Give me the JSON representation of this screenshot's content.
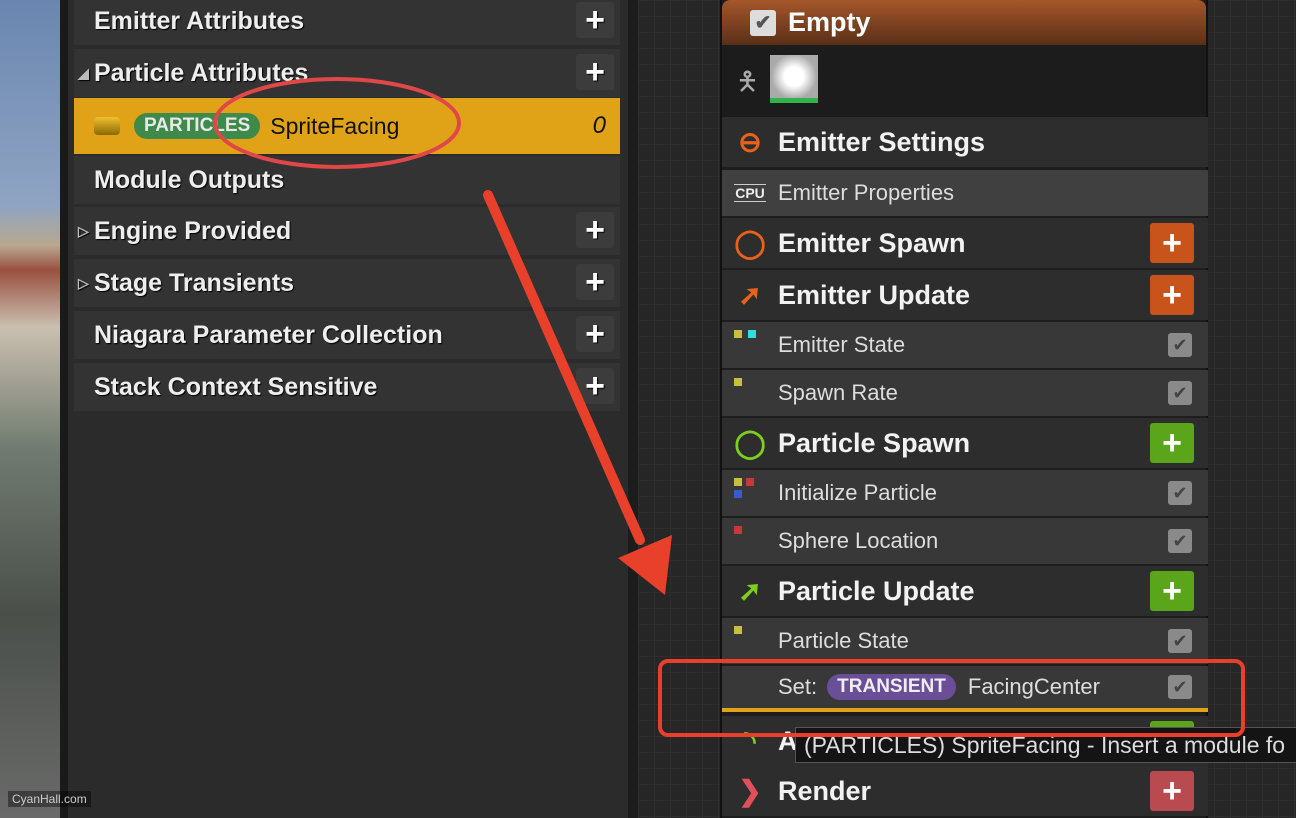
{
  "left_panel": {
    "sections": [
      {
        "label": "Emitter Attributes",
        "expander": "none",
        "has_add": true
      },
      {
        "label": "Particle Attributes",
        "expander": "expanded",
        "has_add": true
      },
      {
        "label": "Module Outputs",
        "expander": "none",
        "has_add": false
      },
      {
        "label": "Engine Provided",
        "expander": "collapsed",
        "has_add": true
      },
      {
        "label": "Stage Transients",
        "expander": "collapsed",
        "has_add": true
      },
      {
        "label": "Niagara Parameter Collection",
        "expander": "none",
        "has_add": true
      },
      {
        "label": "Stack Context Sensitive",
        "expander": "none",
        "has_add": true
      }
    ],
    "selected_param": {
      "namespace": "PARTICLES",
      "name": "SpriteFacing",
      "count": "0",
      "namespace_color": "#3e8a4a",
      "highlight_color": "#e0a317"
    }
  },
  "node": {
    "title": "Empty",
    "rows": [
      {
        "type": "stage",
        "label": "Emitter Settings",
        "icon": "emitter-settings-icon",
        "color": "#e8621a"
      },
      {
        "type": "module",
        "label": "Emitter Properties",
        "icon": "cpu-icon"
      },
      {
        "type": "stage",
        "label": "Emitter Spawn",
        "icon": "ring-icon",
        "color": "#e8621a",
        "add_color": "#c9541b"
      },
      {
        "type": "stage",
        "label": "Emitter Update",
        "icon": "arrow-up-right-icon",
        "color": "#e8621a",
        "add_color": "#c9541b"
      },
      {
        "type": "module",
        "label": "Emitter State",
        "enabled": true
      },
      {
        "type": "module",
        "label": "Spawn Rate",
        "enabled": true
      },
      {
        "type": "stage",
        "label": "Particle Spawn",
        "icon": "ring-icon",
        "color": "#7ccf1c",
        "add_color": "#5aa51a"
      },
      {
        "type": "module",
        "label": "Initialize Particle",
        "enabled": true
      },
      {
        "type": "module",
        "label": "Sphere Location",
        "enabled": true
      },
      {
        "type": "stage",
        "label": "Particle Update",
        "icon": "arrow-up-right-icon",
        "color": "#7ccf1c",
        "add_color": "#5aa51a"
      },
      {
        "type": "module",
        "label": "Particle State",
        "enabled": true
      }
    ],
    "set_row": {
      "prefix": "Set:",
      "namespace": "TRANSIENT",
      "name": "FacingCenter",
      "enabled": true,
      "namespace_color": "#6a4f98"
    },
    "partial_stage_label": "A",
    "render": {
      "label": "Render",
      "color": "#e0505a",
      "add_color": "#b84a50"
    }
  },
  "tooltip": "(PARTICLES) SpriteFacing - Insert a module fo",
  "watermark": "CyanHall.com"
}
